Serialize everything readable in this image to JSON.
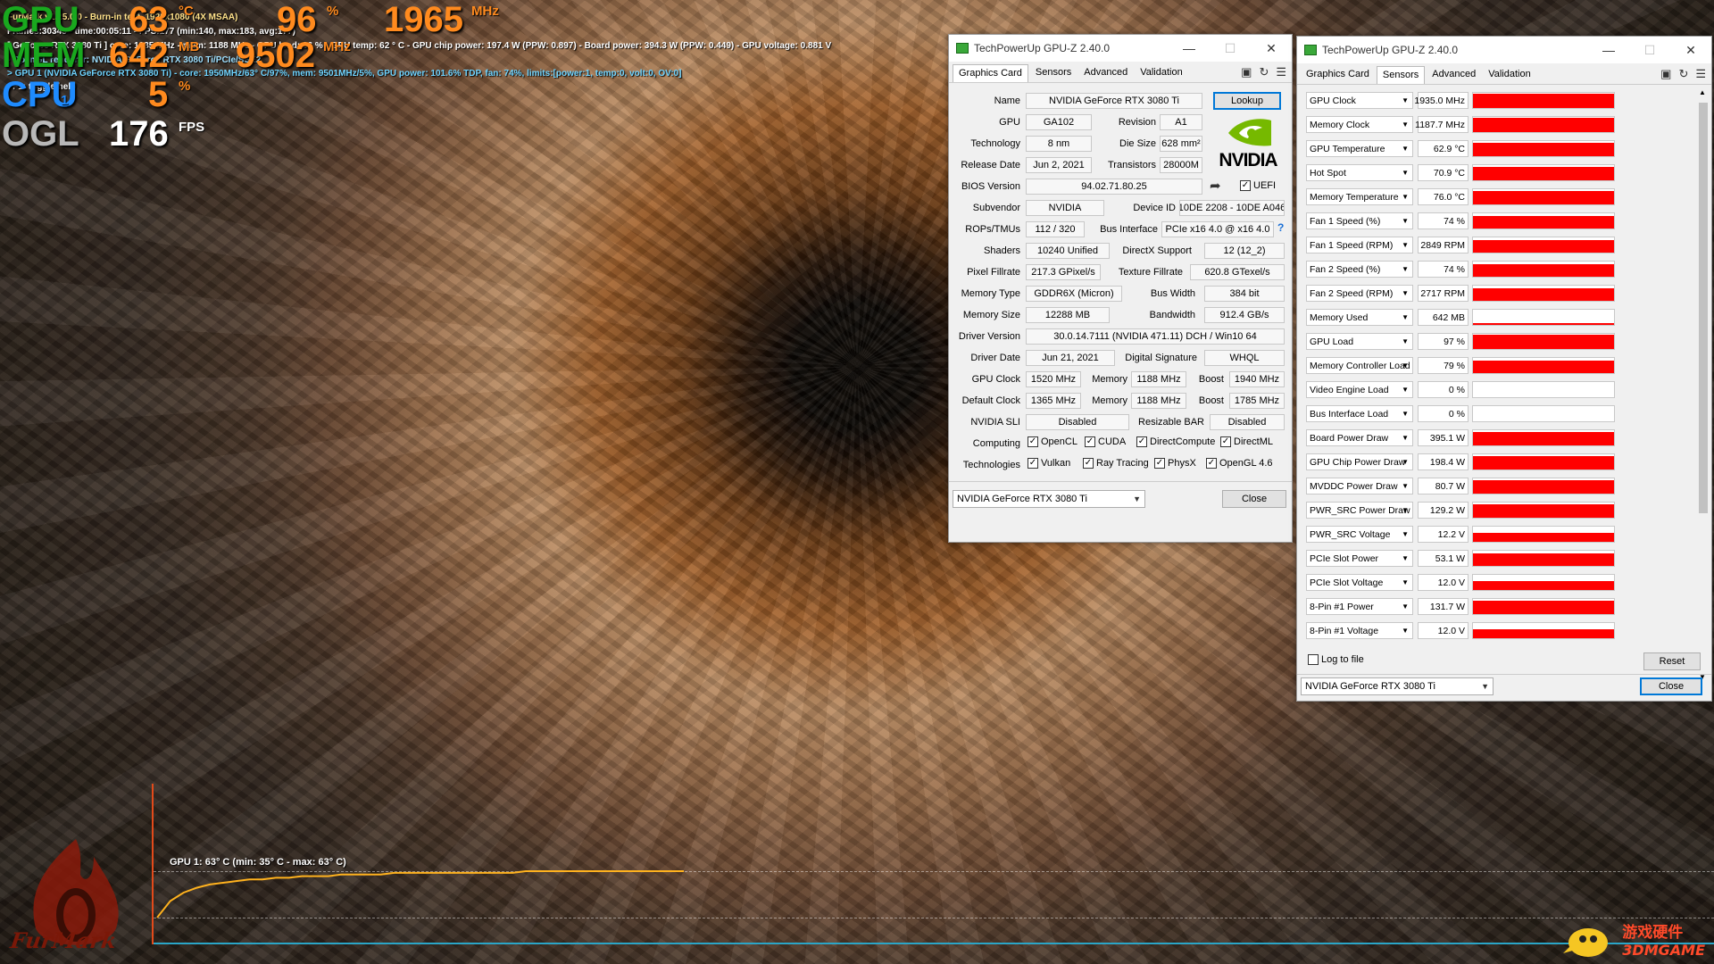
{
  "hud": {
    "gpu_label": "GPU",
    "gpu_temp": "63",
    "gpu_temp_unit": "°C",
    "gpu_load": "96",
    "gpu_load_unit": "%",
    "gpu_clock": "1965",
    "gpu_clock_unit": "MHz",
    "mem_label": "MEM",
    "mem_used": "642",
    "mem_used_unit": "MB",
    "mem_clock": "9502",
    "mem_clock_unit": "MHz",
    "cpu_label": "CPU",
    "cpu_index": "1",
    "cpu_load": "5",
    "cpu_load_unit": "%",
    "api_label": "OGL",
    "fps": "176",
    "fps_unit": "FPS",
    "line1": "FurMark v1.25.0.0 - Burn-in test, 1920x1080 (4X MSAA)",
    "line2": "Frames:30345 - time:00:05:11 - FPS:177 (min:140, max:183, avg:177)",
    "line3": "[ GeForce RTX 3080 Ti ] core: 1935 MHz - mem: 1188 MHz - GPU load: 96 % - GPU temp: 62 ° C - GPU chip power: 197.4 W (PPW: 0.897) - Board power: 394.3 W (PPW: 0.449) - GPU voltage: 0.881 V",
    "line4": "- OpenGL renderer: NVIDIA GeForce RTX 3080 Ti/PCIe/SSE2",
    "line5": "> GPU 1 (NVIDIA GeForce RTX 3080 Ti) - core: 1950MHz/63° C/97%, mem: 9501MHz/5%, GPU power: 101.6% TDP, fan: 74%, limits:[power:1, temp:0, volt:0, OV:0]",
    "line6": "- F1: toggle help",
    "graph_label": "GPU 1: 63° C (min: 35° C - max: 63° C)",
    "graph_temps": [
      35,
      45,
      50,
      53,
      55,
      56,
      57,
      58,
      58,
      59,
      59,
      60,
      60,
      60,
      61,
      61,
      61,
      61,
      62,
      62,
      62,
      62,
      62,
      62,
      62,
      62,
      62,
      62,
      63,
      63,
      63,
      63,
      63,
      63,
      63,
      63,
      63,
      63,
      63,
      63,
      63
    ]
  },
  "win1": {
    "title": "TechPowerUp GPU-Z 2.40.0",
    "tabs": [
      "Graphics Card",
      "Sensors",
      "Advanced",
      "Validation"
    ],
    "name_label": "Name",
    "name": "NVIDIA GeForce RTX 3080 Ti",
    "lookup": "Lookup",
    "gpu_label": "GPU",
    "gpu": "GA102",
    "revision_label": "Revision",
    "revision": "A1",
    "tech_label": "Technology",
    "tech": "8 nm",
    "die_label": "Die Size",
    "die": "628 mm²",
    "release_label": "Release Date",
    "release": "Jun 2, 2021",
    "trans_label": "Transistors",
    "trans": "28000M",
    "bios_label": "BIOS Version",
    "bios": "94.02.71.80.25",
    "uefi": "UEFI",
    "subvendor_label": "Subvendor",
    "subvendor": "NVIDIA",
    "devid_label": "Device ID",
    "devid": "10DE 2208 - 10DE A046",
    "rops_label": "ROPs/TMUs",
    "rops": "112 / 320",
    "bus_label": "Bus Interface",
    "bus": "PCIe x16 4.0 @ x16 4.0",
    "bus_help": "?",
    "shaders_label": "Shaders",
    "shaders": "10240 Unified",
    "dx_label": "DirectX Support",
    "dx": "12 (12_2)",
    "pixel_label": "Pixel Fillrate",
    "pixel": "217.3 GPixel/s",
    "tex_label": "Texture Fillrate",
    "tex": "620.8 GTexel/s",
    "memtype_label": "Memory Type",
    "memtype": "GDDR6X (Micron)",
    "buswidth_label": "Bus Width",
    "buswidth": "384 bit",
    "memsize_label": "Memory Size",
    "memsize": "12288 MB",
    "bandwidth_label": "Bandwidth",
    "bandwidth": "912.4 GB/s",
    "drv_label": "Driver Version",
    "drv": "30.0.14.7111 (NVIDIA 471.11) DCH / Win10 64",
    "drvdate_label": "Driver Date",
    "drvdate": "Jun 21, 2021",
    "sig_label": "Digital Signature",
    "sig": "WHQL",
    "gpuclock_label": "GPU Clock",
    "gpuclock": "1520 MHz",
    "mem_label": "Memory",
    "memclock": "1188 MHz",
    "boost_label": "Boost",
    "boost": "1940 MHz",
    "defclock_label": "Default Clock",
    "defclock": "1365 MHz",
    "defmem": "1188 MHz",
    "defboost": "1785 MHz",
    "sli_label": "NVIDIA SLI",
    "sli": "Disabled",
    "rebar_label": "Resizable BAR",
    "rebar": "Disabled",
    "computing_label": "Computing",
    "opencl": "OpenCL",
    "cuda": "CUDA",
    "dcompute": "DirectCompute",
    "directml": "DirectML",
    "techs_label": "Technologies",
    "vulkan": "Vulkan",
    "raytracing": "Ray Tracing",
    "physx": "PhysX",
    "opengl": "OpenGL 4.6",
    "logo": "NVIDIA",
    "select": "NVIDIA GeForce RTX 3080 Ti",
    "close": "Close"
  },
  "win2": {
    "title": "TechPowerUp GPU-Z 2.40.0",
    "tabs": [
      "Graphics Card",
      "Sensors",
      "Advanced",
      "Validation"
    ],
    "sensors": [
      {
        "name": "GPU Clock",
        "value": "1935.0 MHz",
        "level": 0.95
      },
      {
        "name": "Memory Clock",
        "value": "1187.7 MHz",
        "level": 0.95
      },
      {
        "name": "GPU Temperature",
        "value": "62.9 °C",
        "level": 0.9
      },
      {
        "name": "Hot Spot",
        "value": "70.9 °C",
        "level": 0.9
      },
      {
        "name": "Memory Temperature",
        "value": "76.0 °C",
        "level": 0.9
      },
      {
        "name": "Fan 1 Speed (%)",
        "value": "74 %",
        "level": 0.85
      },
      {
        "name": "Fan 1 Speed (RPM)",
        "value": "2849 RPM",
        "level": 0.85
      },
      {
        "name": "Fan 2 Speed (%)",
        "value": "74 %",
        "level": 0.85
      },
      {
        "name": "Fan 2 Speed (RPM)",
        "value": "2717 RPM",
        "level": 0.85
      },
      {
        "name": "Memory Used",
        "value": "642 MB",
        "level": 0.1
      },
      {
        "name": "GPU Load",
        "value": "97 %",
        "level": 0.95
      },
      {
        "name": "Memory Controller Load",
        "value": "79 %",
        "level": 0.8
      },
      {
        "name": "Video Engine Load",
        "value": "0 %",
        "level": 0
      },
      {
        "name": "Bus Interface Load",
        "value": "0 %",
        "level": 0
      },
      {
        "name": "Board Power Draw",
        "value": "395.1 W",
        "level": 0.9
      },
      {
        "name": "GPU Chip Power Draw",
        "value": "198.4 W",
        "level": 0.9
      },
      {
        "name": "MVDDC Power Draw",
        "value": "80.7 W",
        "level": 0.9
      },
      {
        "name": "PWR_SRC Power Draw",
        "value": "129.2 W",
        "level": 0.9
      },
      {
        "name": "PWR_SRC Voltage",
        "value": "12.2 V",
        "level": 0.6
      },
      {
        "name": "PCIe Slot Power",
        "value": "53.1 W",
        "level": 0.85
      },
      {
        "name": "PCIe Slot Voltage",
        "value": "12.0 V",
        "level": 0.6
      },
      {
        "name": "8-Pin #1 Power",
        "value": "131.7 W",
        "level": 0.9
      },
      {
        "name": "8-Pin #1 Voltage",
        "value": "12.0 V",
        "level": 0.6
      }
    ],
    "log": "Log to file",
    "reset": "Reset",
    "select": "NVIDIA GeForce RTX 3080 Ti",
    "close": "Close"
  },
  "watermark": {
    "cn": "游戏硬件",
    "en": "3DMGAME"
  },
  "furmark_logo": "FurMark"
}
